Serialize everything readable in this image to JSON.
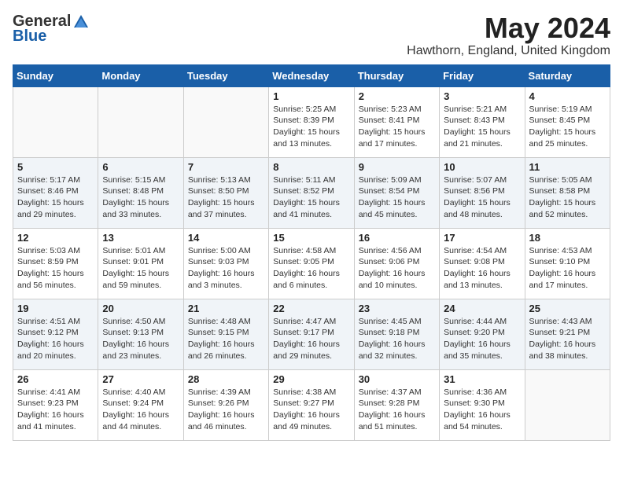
{
  "header": {
    "logo_general": "General",
    "logo_blue": "Blue",
    "month_title": "May 2024",
    "location": "Hawthorn, England, United Kingdom"
  },
  "days_of_week": [
    "Sunday",
    "Monday",
    "Tuesday",
    "Wednesday",
    "Thursday",
    "Friday",
    "Saturday"
  ],
  "weeks": [
    [
      {
        "day": "",
        "info": ""
      },
      {
        "day": "",
        "info": ""
      },
      {
        "day": "",
        "info": ""
      },
      {
        "day": "1",
        "info": "Sunrise: 5:25 AM\nSunset: 8:39 PM\nDaylight: 15 hours\nand 13 minutes."
      },
      {
        "day": "2",
        "info": "Sunrise: 5:23 AM\nSunset: 8:41 PM\nDaylight: 15 hours\nand 17 minutes."
      },
      {
        "day": "3",
        "info": "Sunrise: 5:21 AM\nSunset: 8:43 PM\nDaylight: 15 hours\nand 21 minutes."
      },
      {
        "day": "4",
        "info": "Sunrise: 5:19 AM\nSunset: 8:45 PM\nDaylight: 15 hours\nand 25 minutes."
      }
    ],
    [
      {
        "day": "5",
        "info": "Sunrise: 5:17 AM\nSunset: 8:46 PM\nDaylight: 15 hours\nand 29 minutes."
      },
      {
        "day": "6",
        "info": "Sunrise: 5:15 AM\nSunset: 8:48 PM\nDaylight: 15 hours\nand 33 minutes."
      },
      {
        "day": "7",
        "info": "Sunrise: 5:13 AM\nSunset: 8:50 PM\nDaylight: 15 hours\nand 37 minutes."
      },
      {
        "day": "8",
        "info": "Sunrise: 5:11 AM\nSunset: 8:52 PM\nDaylight: 15 hours\nand 41 minutes."
      },
      {
        "day": "9",
        "info": "Sunrise: 5:09 AM\nSunset: 8:54 PM\nDaylight: 15 hours\nand 45 minutes."
      },
      {
        "day": "10",
        "info": "Sunrise: 5:07 AM\nSunset: 8:56 PM\nDaylight: 15 hours\nand 48 minutes."
      },
      {
        "day": "11",
        "info": "Sunrise: 5:05 AM\nSunset: 8:58 PM\nDaylight: 15 hours\nand 52 minutes."
      }
    ],
    [
      {
        "day": "12",
        "info": "Sunrise: 5:03 AM\nSunset: 8:59 PM\nDaylight: 15 hours\nand 56 minutes."
      },
      {
        "day": "13",
        "info": "Sunrise: 5:01 AM\nSunset: 9:01 PM\nDaylight: 15 hours\nand 59 minutes."
      },
      {
        "day": "14",
        "info": "Sunrise: 5:00 AM\nSunset: 9:03 PM\nDaylight: 16 hours\nand 3 minutes."
      },
      {
        "day": "15",
        "info": "Sunrise: 4:58 AM\nSunset: 9:05 PM\nDaylight: 16 hours\nand 6 minutes."
      },
      {
        "day": "16",
        "info": "Sunrise: 4:56 AM\nSunset: 9:06 PM\nDaylight: 16 hours\nand 10 minutes."
      },
      {
        "day": "17",
        "info": "Sunrise: 4:54 AM\nSunset: 9:08 PM\nDaylight: 16 hours\nand 13 minutes."
      },
      {
        "day": "18",
        "info": "Sunrise: 4:53 AM\nSunset: 9:10 PM\nDaylight: 16 hours\nand 17 minutes."
      }
    ],
    [
      {
        "day": "19",
        "info": "Sunrise: 4:51 AM\nSunset: 9:12 PM\nDaylight: 16 hours\nand 20 minutes."
      },
      {
        "day": "20",
        "info": "Sunrise: 4:50 AM\nSunset: 9:13 PM\nDaylight: 16 hours\nand 23 minutes."
      },
      {
        "day": "21",
        "info": "Sunrise: 4:48 AM\nSunset: 9:15 PM\nDaylight: 16 hours\nand 26 minutes."
      },
      {
        "day": "22",
        "info": "Sunrise: 4:47 AM\nSunset: 9:17 PM\nDaylight: 16 hours\nand 29 minutes."
      },
      {
        "day": "23",
        "info": "Sunrise: 4:45 AM\nSunset: 9:18 PM\nDaylight: 16 hours\nand 32 minutes."
      },
      {
        "day": "24",
        "info": "Sunrise: 4:44 AM\nSunset: 9:20 PM\nDaylight: 16 hours\nand 35 minutes."
      },
      {
        "day": "25",
        "info": "Sunrise: 4:43 AM\nSunset: 9:21 PM\nDaylight: 16 hours\nand 38 minutes."
      }
    ],
    [
      {
        "day": "26",
        "info": "Sunrise: 4:41 AM\nSunset: 9:23 PM\nDaylight: 16 hours\nand 41 minutes."
      },
      {
        "day": "27",
        "info": "Sunrise: 4:40 AM\nSunset: 9:24 PM\nDaylight: 16 hours\nand 44 minutes."
      },
      {
        "day": "28",
        "info": "Sunrise: 4:39 AM\nSunset: 9:26 PM\nDaylight: 16 hours\nand 46 minutes."
      },
      {
        "day": "29",
        "info": "Sunrise: 4:38 AM\nSunset: 9:27 PM\nDaylight: 16 hours\nand 49 minutes."
      },
      {
        "day": "30",
        "info": "Sunrise: 4:37 AM\nSunset: 9:28 PM\nDaylight: 16 hours\nand 51 minutes."
      },
      {
        "day": "31",
        "info": "Sunrise: 4:36 AM\nSunset: 9:30 PM\nDaylight: 16 hours\nand 54 minutes."
      },
      {
        "day": "",
        "info": ""
      }
    ]
  ]
}
